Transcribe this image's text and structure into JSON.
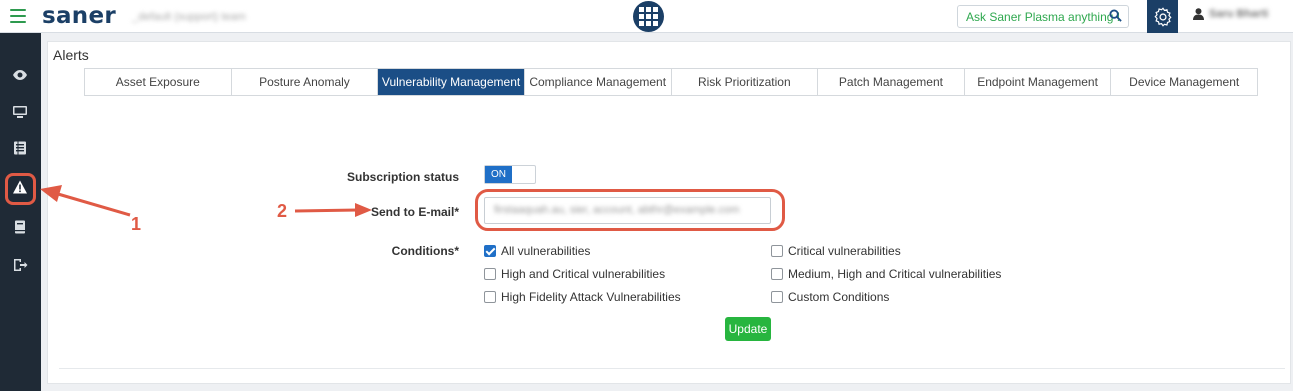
{
  "header": {
    "logo": "saner",
    "org_name": "_default (support) team",
    "ask_placeholder": "Ask Saner Plasma anything !",
    "user_name": "Saru Bharti"
  },
  "sidebar": {
    "items": [
      {
        "icon": "eye-icon"
      },
      {
        "icon": "monitor-icon"
      },
      {
        "icon": "list-icon"
      },
      {
        "icon": "alert-icon",
        "active": true
      },
      {
        "icon": "book-icon"
      },
      {
        "icon": "export-icon"
      }
    ]
  },
  "page": {
    "title": "Alerts"
  },
  "tabs": [
    {
      "label": "Asset Exposure"
    },
    {
      "label": "Posture Anomaly"
    },
    {
      "label": "Vulnerability Management",
      "active": true
    },
    {
      "label": "Compliance Management"
    },
    {
      "label": "Risk Prioritization"
    },
    {
      "label": "Patch Management"
    },
    {
      "label": "Endpoint Management"
    },
    {
      "label": "Device Management"
    }
  ],
  "form": {
    "subscription_label": "Subscription status",
    "subscription_value": "ON",
    "email_label": "Send to E-mail*",
    "email_value": "firstaaquah.au, sier, account, abthr@example.com",
    "conditions_label": "Conditions*",
    "conditions": [
      {
        "label": "All vulnerabilities",
        "checked": true
      },
      {
        "label": "Critical vulnerabilities",
        "checked": false
      },
      {
        "label": "High and Critical vulnerabilities",
        "checked": false
      },
      {
        "label": "Medium, High and Critical vulnerabilities",
        "checked": false
      },
      {
        "label": "High Fidelity Attack Vulnerabilities",
        "checked": false
      },
      {
        "label": "Custom Conditions",
        "checked": false
      }
    ],
    "update_label": "Update"
  },
  "annotations": {
    "one": "1",
    "two": "2"
  },
  "colors": {
    "brand": "#1b3f66",
    "active_tab": "#1b4e86",
    "accent_green": "#27b53f",
    "annotation_red": "#e05a45"
  }
}
